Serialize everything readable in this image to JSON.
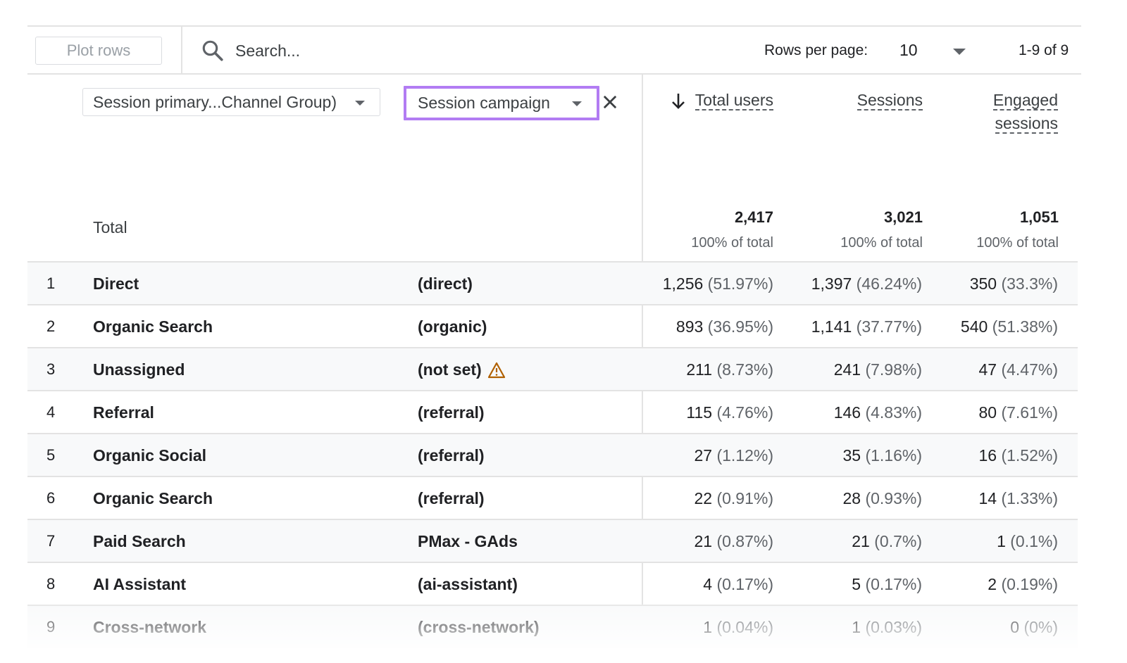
{
  "toolbar": {
    "plot_rows_label": "Plot rows",
    "search_placeholder": "Search...",
    "rows_per_page_label": "Rows per page:",
    "rows_per_page_value": "10",
    "pagination": "1-9 of 9"
  },
  "dimensions": {
    "primary": "Session primary...Channel Group)",
    "secondary": "Session campaign"
  },
  "metrics": {
    "total_users": "Total users",
    "sessions": "Sessions",
    "engaged_line1": "Engaged",
    "engaged_line2": "sessions"
  },
  "totals": {
    "label": "Total",
    "total_users": "2,417",
    "total_users_pct": "100% of total",
    "sessions": "3,021",
    "sessions_pct": "100% of total",
    "engaged": "1,051",
    "engaged_pct": "100% of total"
  },
  "rows": [
    {
      "idx": "1",
      "channel": "Direct",
      "campaign": "(direct)",
      "users": "1,256",
      "users_pct": "(51.97%)",
      "sessions": "1,397",
      "sessions_pct": "(46.24%)",
      "engaged": "350",
      "engaged_pct": "(33.3%)"
    },
    {
      "idx": "2",
      "channel": "Organic Search",
      "campaign": "(organic)",
      "users": "893",
      "users_pct": "(36.95%)",
      "sessions": "1,141",
      "sessions_pct": "(37.77%)",
      "engaged": "540",
      "engaged_pct": "(51.38%)"
    },
    {
      "idx": "3",
      "channel": "Unassigned",
      "campaign": "(not set)",
      "users": "211",
      "users_pct": "(8.73%)",
      "sessions": "241",
      "sessions_pct": "(7.98%)",
      "engaged": "47",
      "engaged_pct": "(4.47%)"
    },
    {
      "idx": "4",
      "channel": "Referral",
      "campaign": "(referral)",
      "users": "115",
      "users_pct": "(4.76%)",
      "sessions": "146",
      "sessions_pct": "(4.83%)",
      "engaged": "80",
      "engaged_pct": "(7.61%)"
    },
    {
      "idx": "5",
      "channel": "Organic Social",
      "campaign": "(referral)",
      "users": "27",
      "users_pct": "(1.12%)",
      "sessions": "35",
      "sessions_pct": "(1.16%)",
      "engaged": "16",
      "engaged_pct": "(1.52%)"
    },
    {
      "idx": "6",
      "channel": "Organic Search",
      "campaign": "(referral)",
      "users": "22",
      "users_pct": "(0.91%)",
      "sessions": "28",
      "sessions_pct": "(0.93%)",
      "engaged": "14",
      "engaged_pct": "(1.33%)"
    },
    {
      "idx": "7",
      "channel": "Paid Search",
      "campaign": "PMax - GAds",
      "users": "21",
      "users_pct": "(0.87%)",
      "sessions": "21",
      "sessions_pct": "(0.7%)",
      "engaged": "1",
      "engaged_pct": "(0.1%)"
    },
    {
      "idx": "8",
      "channel": "AI Assistant",
      "campaign": "(ai-assistant)",
      "users": "4",
      "users_pct": "(0.17%)",
      "sessions": "5",
      "sessions_pct": "(0.17%)",
      "engaged": "2",
      "engaged_pct": "(0.19%)"
    },
    {
      "idx": "9",
      "channel": "Cross-network",
      "campaign": "(cross-network)",
      "users": "1",
      "users_pct": "(0.04%)",
      "sessions": "1",
      "sessions_pct": "(0.03%)",
      "engaged": "0",
      "engaged_pct": "(0%)"
    }
  ],
  "colors": {
    "highlight": "#b27cf3",
    "warning": "#b06000",
    "divider": "#e3e3e3"
  }
}
